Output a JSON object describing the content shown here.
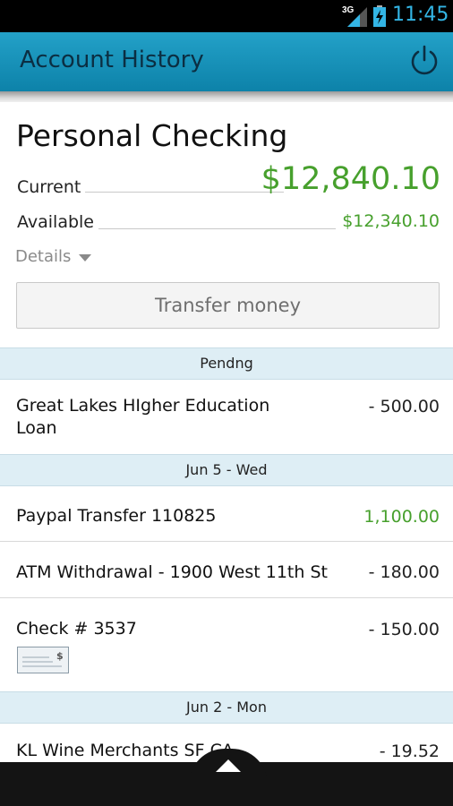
{
  "status_bar": {
    "network": "3G",
    "time": "11:45"
  },
  "action_bar": {
    "title": "Account History"
  },
  "account": {
    "name": "Personal Checking",
    "current_label": "Current",
    "current_value": "$12,840.10",
    "available_label": "Available",
    "available_value": "$12,340.10",
    "details_label": "Details"
  },
  "transfer_button": {
    "label": "Transfer money"
  },
  "sections": [
    {
      "header": "Pendng"
    },
    {
      "header": "Jun 5 - Wed"
    },
    {
      "header": "Jun 2 - Mon"
    }
  ],
  "transactions": [
    {
      "description": "Great Lakes HIgher Education Loan",
      "amount": "- 500.00"
    },
    {
      "description": "Paypal Transfer 110825",
      "amount": "1,100.00"
    },
    {
      "description": "ATM Withdrawal - 1900 West 11th St",
      "amount": "- 180.00"
    },
    {
      "description": "Check # 3537",
      "amount": "- 150.00"
    },
    {
      "description": "KL Wine Merchants SF CA",
      "amount": "- 19.52"
    }
  ],
  "colors": {
    "accent": "#1c95bd",
    "credit": "#47a02d",
    "section_bg": "#deeef5"
  }
}
